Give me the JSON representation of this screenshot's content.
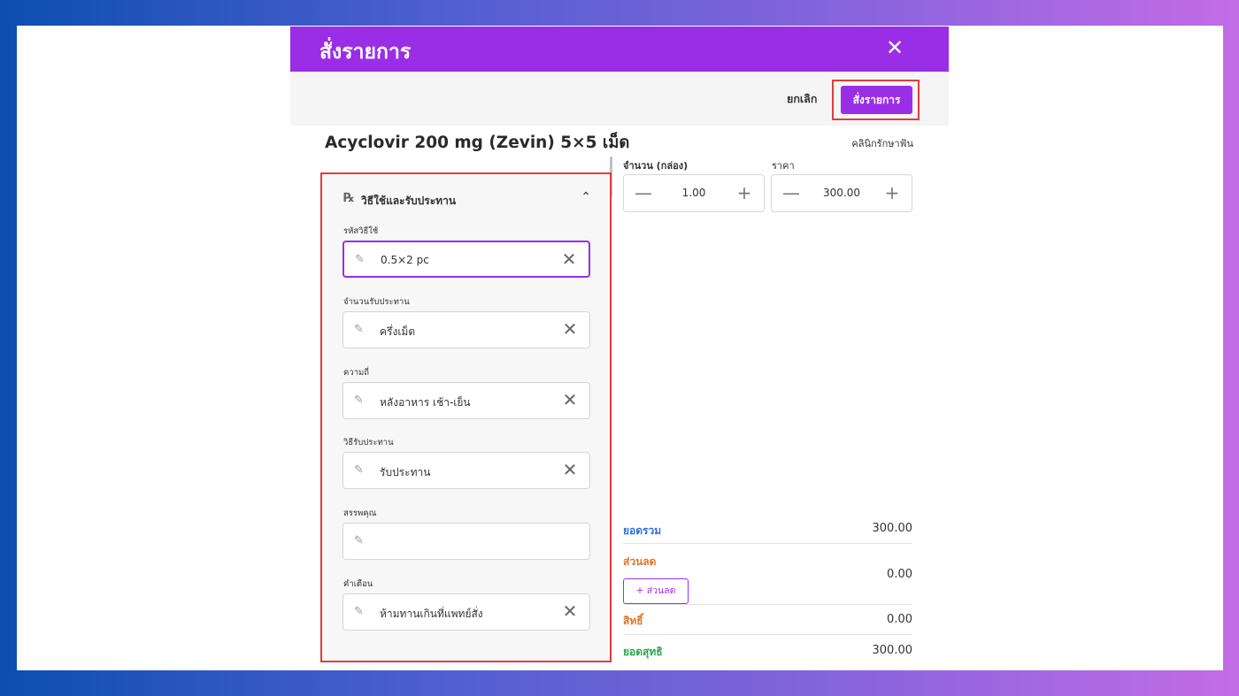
{
  "modal": {
    "title": "สั่งรายการ",
    "close_icon": "✕"
  },
  "toolbar": {
    "cancel_label": "ยกเลิก",
    "order_label": "สั่งรายการ"
  },
  "drug": {
    "name": "Acyclovir 200 mg (Zevin) 5×5 เม็ด",
    "clinic": "คลินิกรักษาฟัน"
  },
  "usage": {
    "section_title": "วิธีใช้และรับประทาน",
    "fields": [
      {
        "label": "รหัสวิธีใช้",
        "value": "0.5×2 pc"
      },
      {
        "label": "จำนวนรับประทาน",
        "value": "ครึ่งเม็ด"
      },
      {
        "label": "ความถี่",
        "value": "หลังอาหาร เช้า-เย็น"
      },
      {
        "label": "วิธีรับประทาน",
        "value": "รับประทาน"
      },
      {
        "label": "สรรพคุณ",
        "value": ""
      },
      {
        "label": "คำเตือน",
        "value": "ห้ามทานเกินที่แพทย์สั่ง"
      }
    ]
  },
  "order": {
    "quantity_label": "จำนวน (กล่อง)",
    "quantity_value": "1.00",
    "price_label": "ราคา",
    "price_value": "300.00"
  },
  "summary": {
    "total_label": "ยอดรวม",
    "total_value": "300.00",
    "discount_label": "ส่วนลด",
    "discount_value": "0.00",
    "discount_button": "+ ส่วนลด",
    "entitlement_label": "สิทธิ์",
    "entitlement_value": "0.00",
    "net_label": "ยอดสุทธิ",
    "net_value": "300.00"
  },
  "colors": {
    "accent": "#9a2ee6",
    "highlight": "#e23b3b",
    "total": "#2f6fd6",
    "discount": "#e0752b",
    "entitlement": "#e0752b",
    "net": "#2ea44f"
  },
  "icons": {
    "edit": "✎",
    "clear": "✕",
    "rx": "℞",
    "chevron_up": "⌃",
    "minus": "—",
    "plus": "+"
  }
}
